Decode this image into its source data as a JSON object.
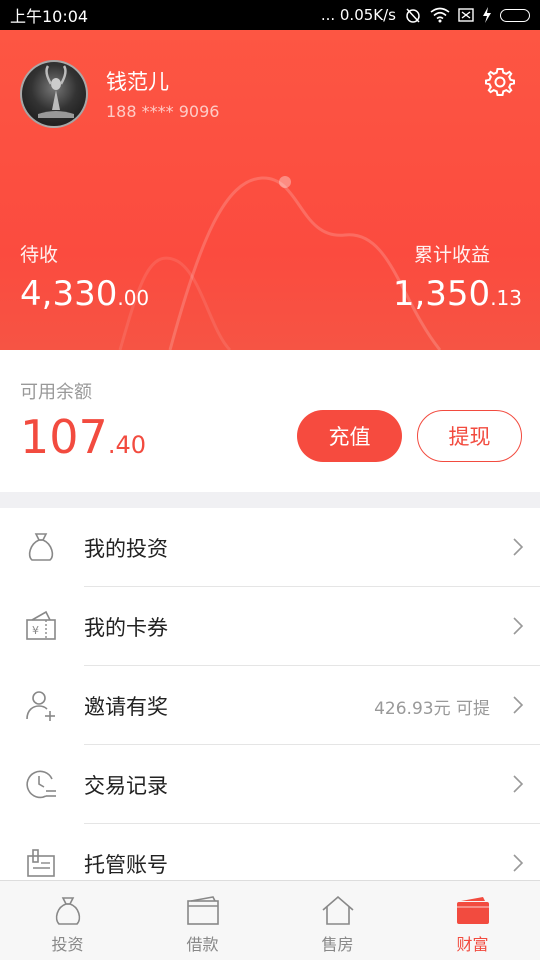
{
  "status_bar": {
    "time": "上午10:04",
    "speed": "... 0.05K/s"
  },
  "profile": {
    "name": "钱范儿",
    "phone": "188 **** 9096"
  },
  "summary": {
    "pending_label": "待收",
    "pending_int": "4,330",
    "pending_dec": ".00",
    "earnings_label": "累计收益",
    "earnings_int": "1,350",
    "earnings_dec": ".13"
  },
  "balance": {
    "label": "可用余额",
    "amount_int": "107",
    "amount_dec": ".40",
    "recharge_label": "充值",
    "withdraw_label": "提现"
  },
  "menu": {
    "items": [
      {
        "label": "我的投资",
        "icon": "money-bag-icon",
        "extra": ""
      },
      {
        "label": "我的卡券",
        "icon": "coupon-icon",
        "extra": ""
      },
      {
        "label": "邀请有奖",
        "icon": "invite-user-icon",
        "extra": "426.93元 可提"
      },
      {
        "label": "交易记录",
        "icon": "clock-record-icon",
        "extra": ""
      },
      {
        "label": "托管账号",
        "icon": "account-document-icon",
        "extra": ""
      }
    ]
  },
  "tabbar": {
    "tabs": [
      {
        "label": "投资",
        "icon": "money-bag-icon",
        "active": false
      },
      {
        "label": "借款",
        "icon": "wallet-icon",
        "active": false
      },
      {
        "label": "售房",
        "icon": "house-icon",
        "active": false
      },
      {
        "label": "财富",
        "icon": "wealth-wallet-icon",
        "active": true
      }
    ]
  },
  "colors": {
    "accent": "#f24b3f",
    "header": "#fb4b3f",
    "muted_text": "#999999"
  }
}
